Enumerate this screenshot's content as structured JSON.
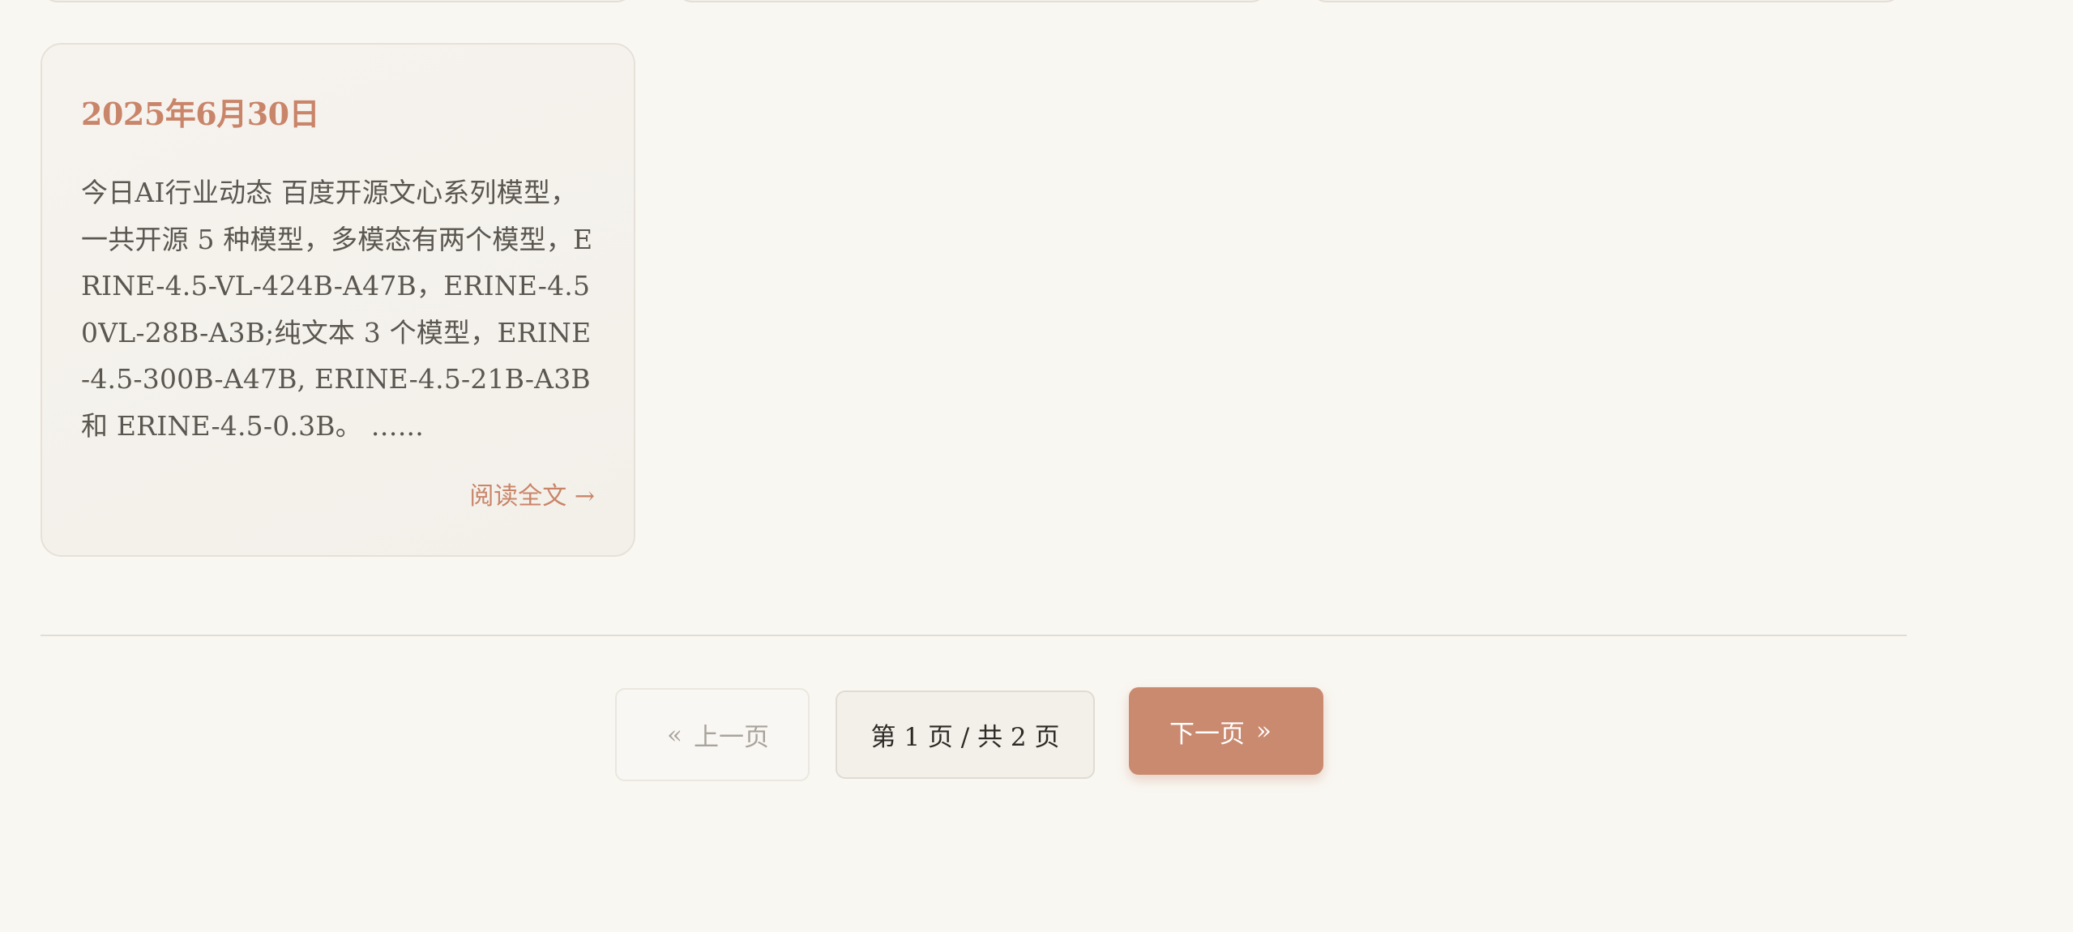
{
  "cards": [
    {
      "date": "2025年6月30日",
      "excerpt": "今日AI行业动态 百度开源文心系列模型，一共开源 5 种模型，多模态有两个模型，ERINE-4.5-VL-424B-A47B，ERINE-4.50VL-28B-A3B;纯文本 3 个模型，ERINE-4.5-300B-A47B, ERINE-4.5-21B-A3B 和 ERINE-4.5-0.3B。 …...",
      "read_more": "阅读全文 →"
    }
  ],
  "pagination": {
    "prev_chevron": "«",
    "prev_label": "上一页",
    "info": "第 1 页 / 共 2 页",
    "next_label": "下一页",
    "next_chevron": "»",
    "current_page": 1,
    "total_pages": 2,
    "prev_disabled": true
  },
  "colors": {
    "background": "#f9f7f2",
    "accent": "#c98a70",
    "date_text": "#c98569",
    "body_text": "#5a5650",
    "card_border": "#e6e1d8"
  }
}
